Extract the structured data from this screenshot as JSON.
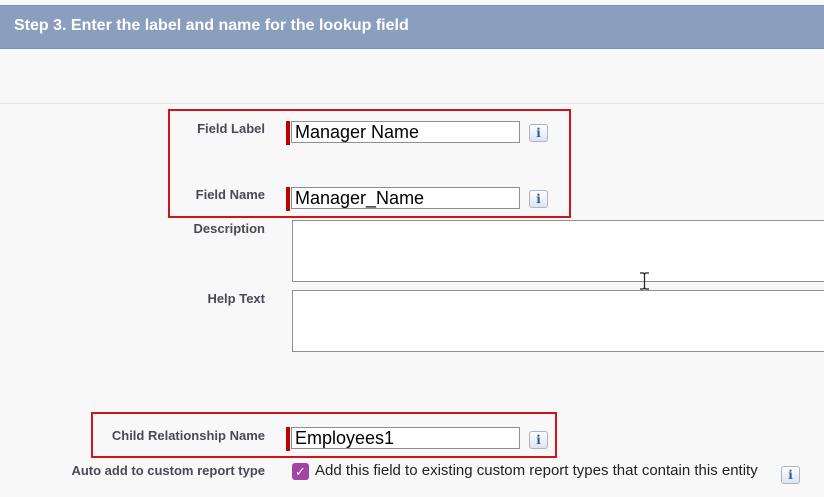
{
  "header": {
    "title": "Step 3. Enter the label and name for the lookup field"
  },
  "fields": {
    "field_label": {
      "label": "Field Label",
      "value": "Manager Name"
    },
    "field_name": {
      "label": "Field Name",
      "value": "Manager_Name"
    },
    "description": {
      "label": "Description",
      "value": ""
    },
    "help_text": {
      "label": "Help Text",
      "value": ""
    },
    "child_relationship_name": {
      "label": "Child Relationship Name",
      "value": "Employees1"
    },
    "auto_add": {
      "label": "Auto add to custom report type",
      "checkbox_label": "Add this field to existing custom report types that contain this entity",
      "checked": true
    }
  },
  "icons": {
    "info": "i",
    "check": "✓"
  },
  "colors": {
    "header_bg": "#8a9ebe",
    "required_bar": "#c00000",
    "highlight_box": "#d0141b",
    "checkbox_bg": "#a245a6"
  }
}
